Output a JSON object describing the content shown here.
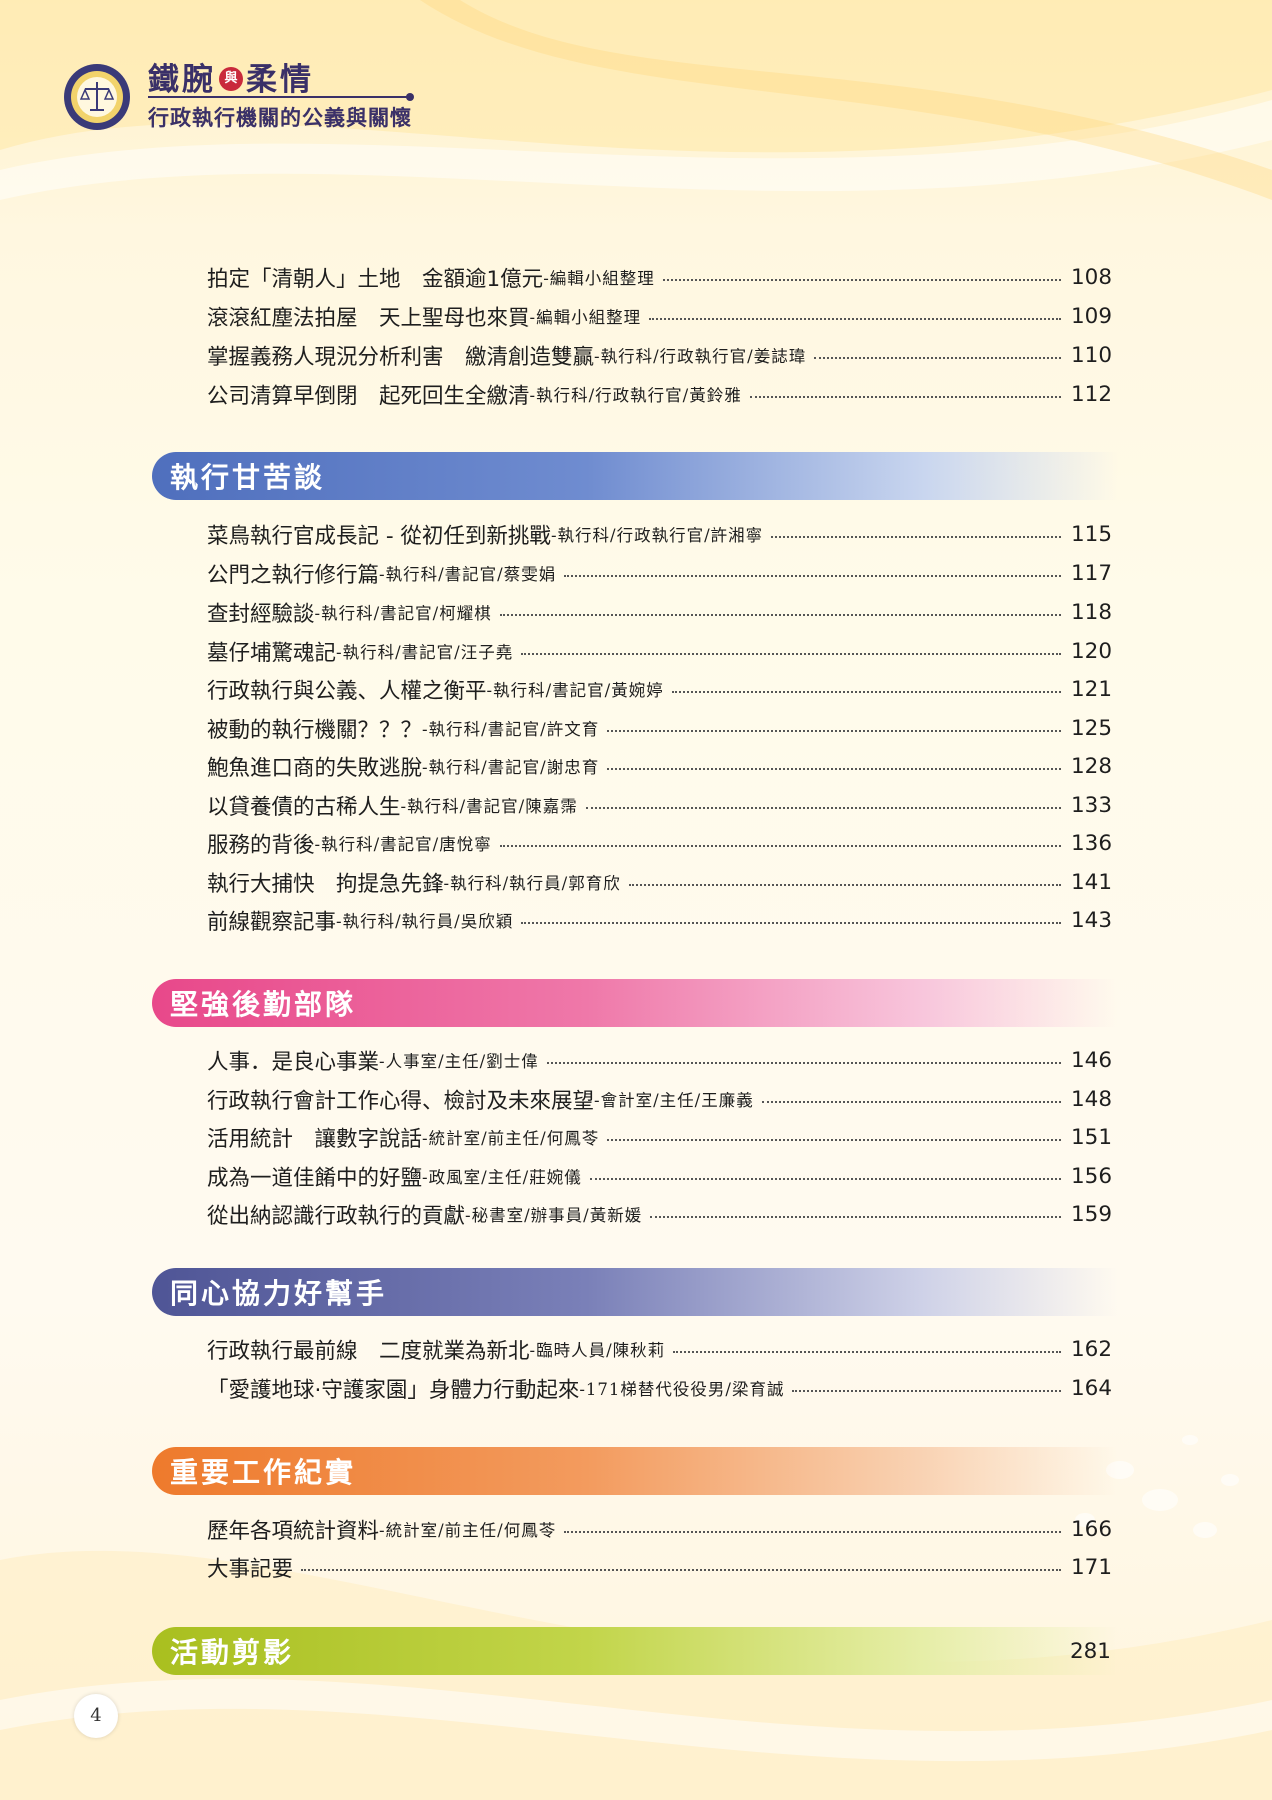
{
  "header": {
    "brand_title_part1": "鐵腕",
    "brand_title_mid": "與",
    "brand_title_part2": "柔情",
    "brand_subtitle": "行政執行機關的公義與關懷"
  },
  "colors": {
    "section_blue": "#4f6fbd",
    "section_pink": "#e8488a",
    "section_indigo": "#4f5596",
    "section_orange": "#ee7a2c",
    "section_green": "#a9bf1f"
  },
  "entries_top": [
    {
      "title": "拍定「清朝人」土地　金額逾1億元",
      "author": "-編輯小組整理",
      "page": "108"
    },
    {
      "title": "滾滾紅塵法拍屋　天上聖母也來買",
      "author": "-編輯小組整理",
      "page": "109"
    },
    {
      "title": "掌握義務人現況分析利害　繳清創造雙贏",
      "author": "-執行科/行政執行官/姜誌瑋",
      "page": "110"
    },
    {
      "title": "公司清算早倒閉　起死回生全繳清",
      "author": "-執行科/行政執行官/黃鈴雅",
      "page": "112"
    }
  ],
  "sections": [
    {
      "title": "執行甘苦談",
      "entries": [
        {
          "title": "菜鳥執行官成長記 - 從初任到新挑戰",
          "author": "-執行科/行政執行官/許湘寧",
          "page": "115"
        },
        {
          "title": "公門之執行修行篇",
          "author": "-執行科/書記官/蔡雯娟",
          "page": "117"
        },
        {
          "title": "查封經驗談",
          "author": "-執行科/書記官/柯耀棋",
          "page": "118"
        },
        {
          "title": "墓仔埔驚魂記",
          "author": "-執行科/書記官/汪子堯",
          "page": "120"
        },
        {
          "title": "行政執行與公義、人權之衡平",
          "author": "-執行科/書記官/黃婉婷",
          "page": "121"
        },
        {
          "title": "被動的執行機關？？？",
          "author": "-執行科/書記官/許文育",
          "page": "125"
        },
        {
          "title": "鮑魚進口商的失敗逃脫",
          "author": "-執行科/書記官/謝忠育",
          "page": "128"
        },
        {
          "title": "以貸養債的古稀人生",
          "author": "-執行科/書記官/陳嘉霈",
          "page": "133"
        },
        {
          "title": "服務的背後",
          "author": "-執行科/書記官/唐悅寧",
          "page": "136"
        },
        {
          "title": "執行大捕快　拘提急先鋒",
          "author": "-執行科/執行員/郭育欣",
          "page": "141"
        },
        {
          "title": "前線觀察記事",
          "author": "-執行科/執行員/吳欣穎",
          "page": "143"
        }
      ]
    },
    {
      "title": "堅強後勤部隊",
      "entries": [
        {
          "title": "人事．是良心事業",
          "author": "-人事室/主任/劉士偉",
          "page": "146"
        },
        {
          "title": "行政執行會計工作心得、檢討及未來展望",
          "author": "-會計室/主任/王廉義",
          "page": "148"
        },
        {
          "title": "活用統計　讓數字說話",
          "author": "-統計室/前主任/何鳳苓",
          "page": "151"
        },
        {
          "title": "成為一道佳餚中的好鹽",
          "author": "-政風室/主任/莊婉儀",
          "page": "156"
        },
        {
          "title": "從出納認識行政執行的貢獻",
          "author": "-秘書室/辦事員/黃新媛",
          "page": "159"
        }
      ]
    },
    {
      "title": "同心協力好幫手",
      "entries": [
        {
          "title": "行政執行最前線　二度就業為新北",
          "author": "-臨時人員/陳秋莉",
          "page": "162"
        },
        {
          "title": "「愛護地球·守護家園」身體力行動起來",
          "author": "-171梯替代役役男/梁育誠",
          "page": "164"
        }
      ]
    },
    {
      "title": "重要工作紀實",
      "entries": [
        {
          "title": "歷年各項統計資料",
          "author": "-統計室/前主任/何鳳苓",
          "page": "166"
        },
        {
          "title": "大事記要",
          "author": "",
          "page": "171"
        }
      ]
    },
    {
      "title": "活動剪影",
      "page": "281"
    }
  ],
  "footer": {
    "page_number": "4"
  }
}
